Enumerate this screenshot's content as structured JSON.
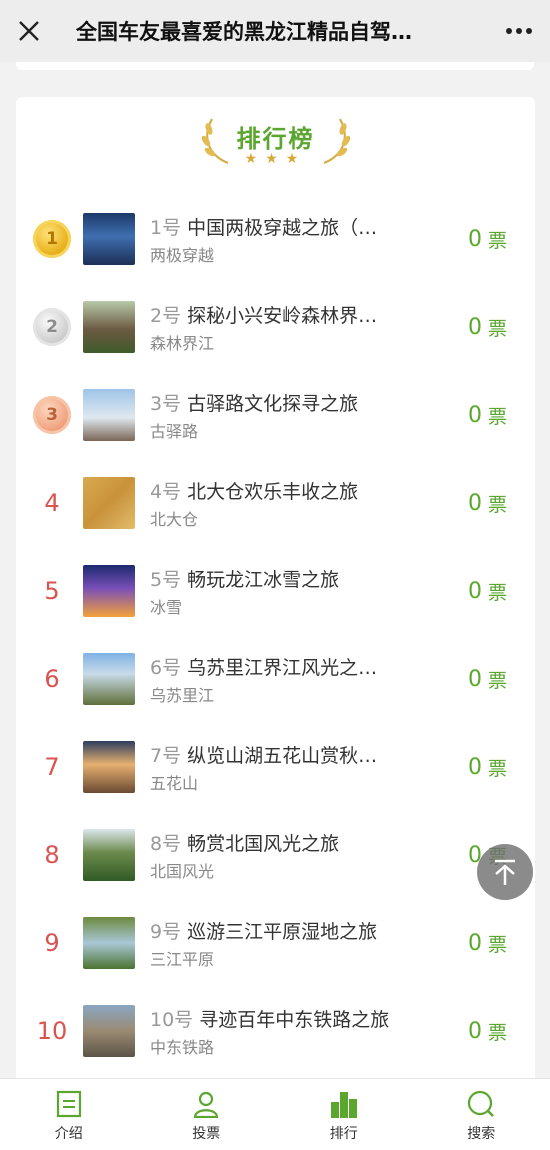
{
  "header": {
    "title": "全国车友最喜爱的黑龙江精品自驾…",
    "close_icon": "close-icon",
    "more_icon": "more-icon"
  },
  "ranking": {
    "title": "排行榜",
    "stars": "★★★",
    "items": [
      {
        "rank": "1",
        "medal": "gold",
        "number": "1号",
        "name": "中国两极穿越之旅（…",
        "subtitle": "两极穿越",
        "votes": "0",
        "unit": "票"
      },
      {
        "rank": "2",
        "medal": "silver",
        "number": "2号",
        "name": "探秘小兴安岭森林界…",
        "subtitle": "森林界江",
        "votes": "0",
        "unit": "票"
      },
      {
        "rank": "3",
        "medal": "bronze",
        "number": "3号",
        "name": "古驿路文化探寻之旅",
        "subtitle": "古驿路",
        "votes": "0",
        "unit": "票"
      },
      {
        "rank": "4",
        "medal": "",
        "number": "4号",
        "name": "北大仓欢乐丰收之旅",
        "subtitle": "北大仓",
        "votes": "0",
        "unit": "票"
      },
      {
        "rank": "5",
        "medal": "",
        "number": "5号",
        "name": "畅玩龙江冰雪之旅",
        "subtitle": "冰雪",
        "votes": "0",
        "unit": "票"
      },
      {
        "rank": "6",
        "medal": "",
        "number": "6号",
        "name": "乌苏里江界江风光之…",
        "subtitle": "乌苏里江",
        "votes": "0",
        "unit": "票"
      },
      {
        "rank": "7",
        "medal": "",
        "number": "7号",
        "name": "纵览山湖五花山赏秋…",
        "subtitle": "五花山",
        "votes": "0",
        "unit": "票"
      },
      {
        "rank": "8",
        "medal": "",
        "number": "8号",
        "name": "畅赏北国风光之旅",
        "subtitle": "北国风光",
        "votes": "0",
        "unit": "票"
      },
      {
        "rank": "9",
        "medal": "",
        "number": "9号",
        "name": "巡游三江平原湿地之旅",
        "subtitle": "三江平原",
        "votes": "0",
        "unit": "票"
      },
      {
        "rank": "10",
        "medal": "",
        "number": "10号",
        "name": "寻迹百年中东铁路之旅",
        "subtitle": "中东铁路",
        "votes": "0",
        "unit": "票"
      }
    ]
  },
  "back_to_top_icon": "arrow-up-icon",
  "tabs": [
    {
      "label": "介绍",
      "icon": "document-icon",
      "active": false
    },
    {
      "label": "投票",
      "icon": "user-icon",
      "active": false
    },
    {
      "label": "排行",
      "icon": "bar-chart-icon",
      "active": true
    },
    {
      "label": "搜索",
      "icon": "search-icon",
      "active": false
    }
  ],
  "colors": {
    "accent": "#5aa62e",
    "rank_red": "#d9534f",
    "gold": "#e8b21c"
  }
}
